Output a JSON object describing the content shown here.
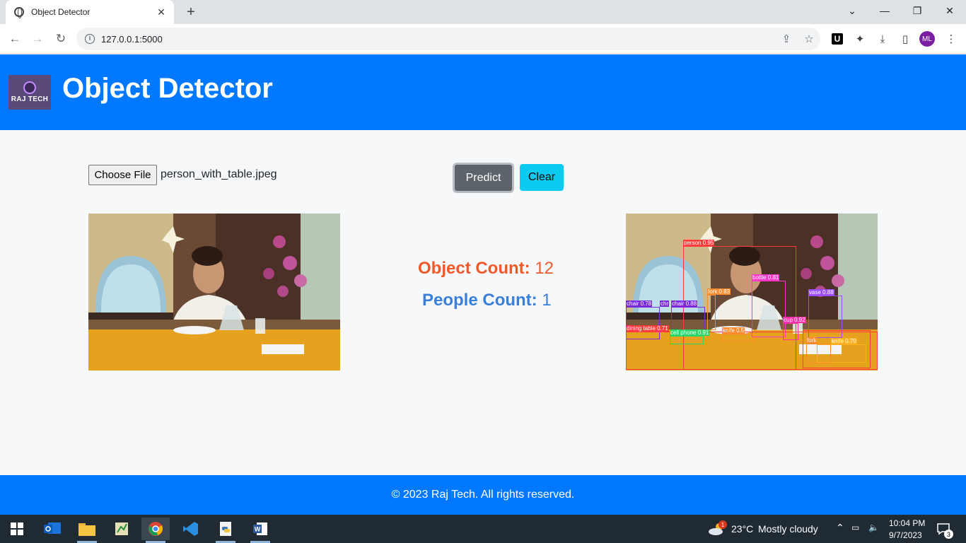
{
  "browser": {
    "tab_title": "Object Detector",
    "new_tab_symbol": "+",
    "close_tab_symbol": "✕",
    "url": "127.0.0.1:5000",
    "profile_initials": "ML"
  },
  "page": {
    "title": "Object Detector",
    "logo_text": "RAJ TECH",
    "choose_file_label": "Choose File",
    "chosen_file": "person_with_table.jpeg",
    "predict_label": "Predict",
    "clear_label": "Clear",
    "object_count_label": "Object Count:",
    "object_count_value": "12",
    "people_count_label": "People Count:",
    "people_count_value": "1",
    "footer": "© 2023 Raj Tech. All rights reserved."
  },
  "detections": [
    {
      "label": "person 0.95",
      "color": "#ff3b3b"
    },
    {
      "label": "bottle 0.81",
      "color": "#ff37c7"
    },
    {
      "label": "fork 0.83",
      "color": "#ff8a2b"
    },
    {
      "label": "vase 0.88",
      "color": "#9b4dff"
    },
    {
      "label": "chair 0.78",
      "color": "#7a2bd6"
    },
    {
      "label": "chr",
      "color": "#7a2bd6"
    },
    {
      "label": "chair 0.88",
      "color": "#7a2bd6"
    },
    {
      "label": "cup 0.92",
      "color": "#ff2fa8"
    },
    {
      "label": "dining table 0.71",
      "color": "#ff3b3b"
    },
    {
      "label": "cell phone 0.91",
      "color": "#2bd66b"
    },
    {
      "label": "knife 0.5",
      "color": "#ff8a2b"
    },
    {
      "label": "fork",
      "color": "#ff8a2b"
    },
    {
      "label": "knife 0.70",
      "color": "#ffb020"
    }
  ],
  "taskbar": {
    "temperature": "23°C",
    "weather": "Mostly cloudy",
    "time": "10:04 PM",
    "date": "9/7/2023",
    "notification_count": "3",
    "weather_badge": "1"
  }
}
